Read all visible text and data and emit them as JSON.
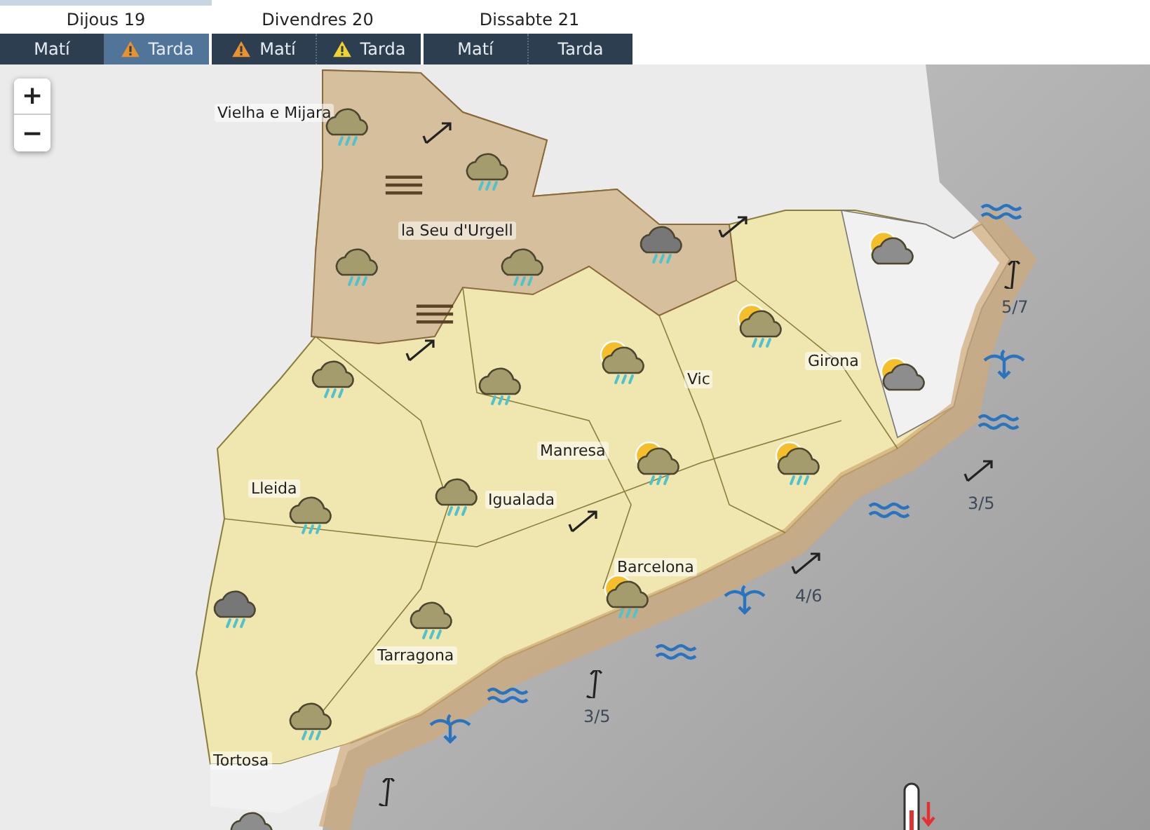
{
  "days": [
    {
      "label": "Dijous 19",
      "selected": true,
      "periods": [
        {
          "label": "Matí",
          "selected": false,
          "warning": false
        },
        {
          "label": "Tarda",
          "selected": true,
          "warning": true,
          "color": "#e8912d"
        }
      ]
    },
    {
      "label": "Divendres 20",
      "selected": false,
      "periods": [
        {
          "label": "Matí",
          "selected": false,
          "warning": true,
          "color": "#e8912d"
        },
        {
          "label": "Tarda",
          "selected": false,
          "warning": true,
          "color": "#f2d22e"
        }
      ]
    },
    {
      "label": "Dissabte 21",
      "selected": false,
      "periods": [
        {
          "label": "Matí",
          "selected": false,
          "warning": false
        },
        {
          "label": "Tarda",
          "selected": false,
          "warning": false
        }
      ]
    }
  ],
  "zoom_controls": [
    {
      "label": "+"
    },
    {
      "label": "−"
    }
  ],
  "map": {
    "places": [
      "Vielha e Mijara",
      "la Seu d'Urgell",
      "Vic",
      "Girona",
      "Manresa",
      "Lleida",
      "Igualada",
      "Barcelona",
      "Tarragona",
      "Tortosa"
    ],
    "symbols": [
      {
        "kind": "rain-cloud"
      },
      {
        "kind": "rain-cloud"
      },
      {
        "kind": "rain-cloud"
      },
      {
        "kind": "rain-cloud"
      },
      {
        "kind": "dark-rain-cloud"
      },
      {
        "kind": "sun-cloud"
      },
      {
        "kind": "rain-cloud"
      },
      {
        "kind": "rain-cloud"
      },
      {
        "kind": "sun-cloud-rain"
      },
      {
        "kind": "sun-cloud-rain"
      },
      {
        "kind": "sun-cloud"
      },
      {
        "kind": "sun-cloud-rain"
      },
      {
        "kind": "sun-cloud-rain"
      },
      {
        "kind": "rain-cloud"
      },
      {
        "kind": "rain-cloud"
      },
      {
        "kind": "dark-rain-cloud"
      },
      {
        "kind": "rain-cloud"
      },
      {
        "kind": "sun-cloud-rain"
      },
      {
        "kind": "rain-cloud"
      },
      {
        "kind": "dark-cloud"
      },
      {
        "kind": "fog"
      },
      {
        "kind": "fog"
      },
      {
        "kind": "wind"
      },
      {
        "kind": "wind"
      },
      {
        "kind": "wind"
      },
      {
        "kind": "wind"
      },
      {
        "kind": "waves"
      },
      {
        "kind": "wind",
        "reading": "5/7"
      },
      {
        "kind": "swirl"
      },
      {
        "kind": "waves"
      },
      {
        "kind": "wind",
        "reading": "3/5"
      },
      {
        "kind": "waves"
      },
      {
        "kind": "swirl"
      },
      {
        "kind": "wind",
        "reading": "4/6"
      },
      {
        "kind": "waves"
      },
      {
        "kind": "waves"
      },
      {
        "kind": "wind",
        "reading": "3/5"
      },
      {
        "kind": "swirl"
      },
      {
        "kind": "wind"
      },
      {
        "kind": "thermometer"
      }
    ]
  }
}
